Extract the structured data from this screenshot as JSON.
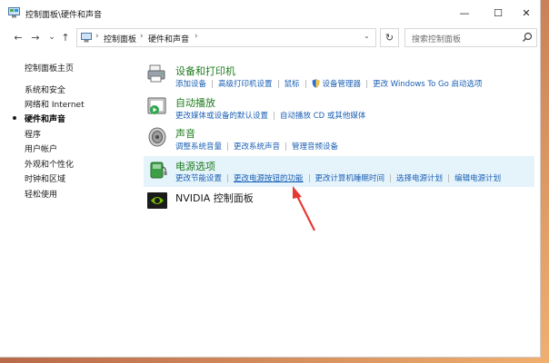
{
  "window": {
    "title": "控制面板\\硬件和声音",
    "controls": {
      "minimize": "—",
      "maximize": "☐",
      "close": "✕"
    }
  },
  "nav": {
    "back": "←",
    "forward": "→",
    "recent": "⌄",
    "up": "↑",
    "refresh": "↻"
  },
  "breadcrumb": [
    "控制面板",
    "硬件和声音"
  ],
  "breadcrumb_sep": "›",
  "search": {
    "placeholder": "搜索控制面板"
  },
  "sidebar": {
    "items": [
      {
        "label": "控制面板主页",
        "active": false
      },
      {
        "label": "系统和安全",
        "active": false
      },
      {
        "label": "网络和 Internet",
        "active": false
      },
      {
        "label": "硬件和声音",
        "active": true
      },
      {
        "label": "程序",
        "active": false
      },
      {
        "label": "用户帐户",
        "active": false
      },
      {
        "label": "外观和个性化",
        "active": false
      },
      {
        "label": "时钟和区域",
        "active": false
      },
      {
        "label": "轻松使用",
        "active": false
      }
    ]
  },
  "categories": [
    {
      "title": "设备和打印机",
      "icon": "printer-icon",
      "links": [
        "添加设备",
        "高级打印机设置",
        "鼠标",
        "设备管理器",
        "更改 Windows To Go 启动选项"
      ]
    },
    {
      "title": "自动播放",
      "icon": "autoplay-icon",
      "links": [
        "更改媒体或设备的默认设置",
        "自动播放 CD 或其他媒体"
      ]
    },
    {
      "title": "声音",
      "icon": "speaker-icon",
      "links": [
        "调整系统音量",
        "更改系统声音",
        "管理音频设备"
      ]
    },
    {
      "title": "电源选项",
      "icon": "power-icon",
      "links": [
        "更改节能设置",
        "更改电源按钮的功能",
        "更改计算机睡眠时间",
        "选择电源计划",
        "编辑电源计划"
      ]
    },
    {
      "title": "NVIDIA 控制面板",
      "icon": "nvidia-icon",
      "links": []
    }
  ],
  "colors": {
    "link": "#1a5fb4",
    "category_title": "#1e7b1e",
    "highlight_row": "#e5f3fb",
    "annotation_arrow": "#e53935"
  }
}
